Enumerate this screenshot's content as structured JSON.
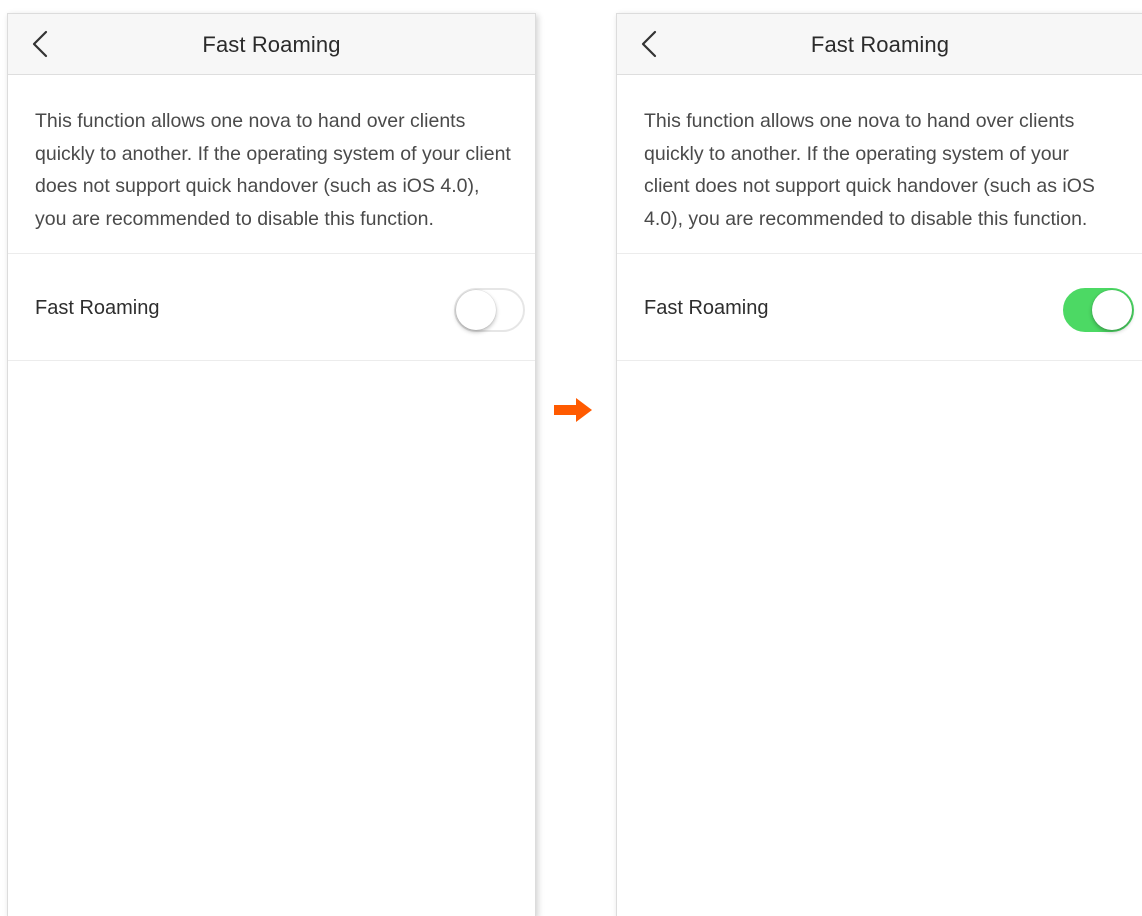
{
  "left_screen": {
    "title": "Fast Roaming",
    "description": "This function allows one nova to hand over clients quickly to another. If the operating system of your client does not support quick handover (such as iOS 4.0), you are recommended to disable this function.",
    "setting_label": "Fast Roaming",
    "toggle_state": "off"
  },
  "right_screen": {
    "title": "Fast Roaming",
    "description": "This function allows one nova to hand over clients quickly to another. If the operating system of your client does not support quick handover (such as iOS 4.0), you are recommended to disable this function.",
    "setting_label": "Fast Roaming",
    "toggle_state": "on"
  },
  "icons": {
    "back": "chevron-left-icon",
    "transition": "arrow-right-icon"
  },
  "colors": {
    "toggle_on": "#4cd964",
    "toggle_off_border": "#e6e6e6",
    "arrow": "#ff5a00",
    "navbar_bg": "#f7f7f7"
  }
}
